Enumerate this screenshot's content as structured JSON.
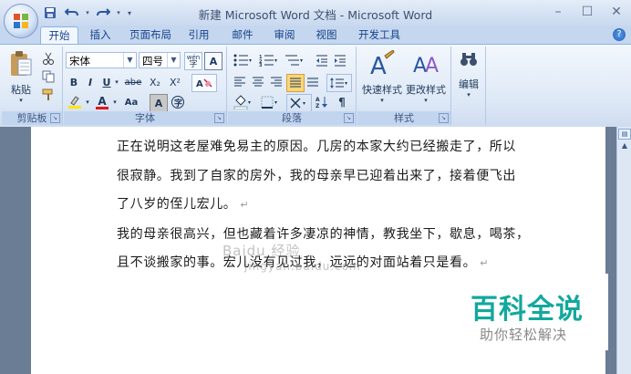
{
  "window": {
    "title": "新建 Microsoft Word 文档 - Microsoft Word",
    "minimize": "–",
    "restore": "☐",
    "close": "✕"
  },
  "tabs": [
    "开始",
    "插入",
    "页面布局",
    "引用",
    "邮件",
    "审阅",
    "视图",
    "开发工具"
  ],
  "help": "?",
  "ribbon": {
    "clipboard": {
      "label": "剪贴板",
      "paste": "粘贴"
    },
    "font": {
      "label": "字体",
      "font_name": "宋体",
      "font_size": "四号",
      "bold": "B",
      "italic": "I",
      "underline": "U",
      "strike": "abe",
      "sub": "X₂",
      "sup": "X²",
      "aa": "Aa",
      "char_border": "A",
      "char_shade": "A",
      "phonetic": "wén",
      "enclose": "字"
    },
    "paragraph": {
      "label": "段落"
    },
    "styles": {
      "label": "样式",
      "quick": "快速样式",
      "change": "更改样式"
    },
    "editing": {
      "label": "编辑"
    }
  },
  "document": {
    "lines": [
      "正在说明这老屋难免易主的原因。几房的本家大约已经搬走了，所以",
      "很寂静。我到了自家的房外，我的母亲早已迎着出来了，接着便飞出",
      "了八岁的侄儿宏儿。",
      "我的母亲很高兴，但也藏着许多凄凉的神情，教我坐下，歇息，喝茶，",
      "且不谈搬家的事。宏儿没有见过我，远远的对面站着只是看。"
    ],
    "para_mark": "↵"
  },
  "watermark": {
    "main": "Baidu 经验",
    "sub": "jingyan.baidu.com"
  },
  "badge": {
    "title": "百科全说",
    "subtitle": "助你轻松解决"
  }
}
